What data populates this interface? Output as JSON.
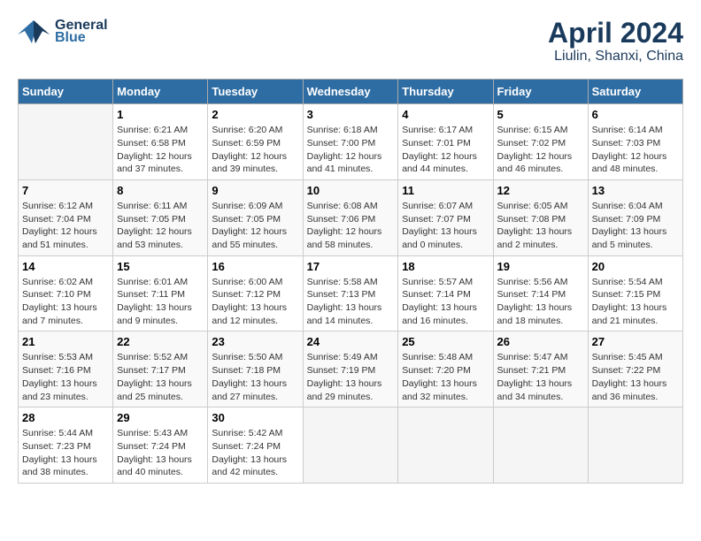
{
  "header": {
    "logo_line1": "General",
    "logo_line2": "Blue",
    "title": "April 2024",
    "subtitle": "Liulin, Shanxi, China"
  },
  "columns": [
    "Sunday",
    "Monday",
    "Tuesday",
    "Wednesday",
    "Thursday",
    "Friday",
    "Saturday"
  ],
  "weeks": [
    [
      {
        "num": "",
        "info": ""
      },
      {
        "num": "1",
        "info": "Sunrise: 6:21 AM\nSunset: 6:58 PM\nDaylight: 12 hours\nand 37 minutes."
      },
      {
        "num": "2",
        "info": "Sunrise: 6:20 AM\nSunset: 6:59 PM\nDaylight: 12 hours\nand 39 minutes."
      },
      {
        "num": "3",
        "info": "Sunrise: 6:18 AM\nSunset: 7:00 PM\nDaylight: 12 hours\nand 41 minutes."
      },
      {
        "num": "4",
        "info": "Sunrise: 6:17 AM\nSunset: 7:01 PM\nDaylight: 12 hours\nand 44 minutes."
      },
      {
        "num": "5",
        "info": "Sunrise: 6:15 AM\nSunset: 7:02 PM\nDaylight: 12 hours\nand 46 minutes."
      },
      {
        "num": "6",
        "info": "Sunrise: 6:14 AM\nSunset: 7:03 PM\nDaylight: 12 hours\nand 48 minutes."
      }
    ],
    [
      {
        "num": "7",
        "info": "Sunrise: 6:12 AM\nSunset: 7:04 PM\nDaylight: 12 hours\nand 51 minutes."
      },
      {
        "num": "8",
        "info": "Sunrise: 6:11 AM\nSunset: 7:05 PM\nDaylight: 12 hours\nand 53 minutes."
      },
      {
        "num": "9",
        "info": "Sunrise: 6:09 AM\nSunset: 7:05 PM\nDaylight: 12 hours\nand 55 minutes."
      },
      {
        "num": "10",
        "info": "Sunrise: 6:08 AM\nSunset: 7:06 PM\nDaylight: 12 hours\nand 58 minutes."
      },
      {
        "num": "11",
        "info": "Sunrise: 6:07 AM\nSunset: 7:07 PM\nDaylight: 13 hours\nand 0 minutes."
      },
      {
        "num": "12",
        "info": "Sunrise: 6:05 AM\nSunset: 7:08 PM\nDaylight: 13 hours\nand 2 minutes."
      },
      {
        "num": "13",
        "info": "Sunrise: 6:04 AM\nSunset: 7:09 PM\nDaylight: 13 hours\nand 5 minutes."
      }
    ],
    [
      {
        "num": "14",
        "info": "Sunrise: 6:02 AM\nSunset: 7:10 PM\nDaylight: 13 hours\nand 7 minutes."
      },
      {
        "num": "15",
        "info": "Sunrise: 6:01 AM\nSunset: 7:11 PM\nDaylight: 13 hours\nand 9 minutes."
      },
      {
        "num": "16",
        "info": "Sunrise: 6:00 AM\nSunset: 7:12 PM\nDaylight: 13 hours\nand 12 minutes."
      },
      {
        "num": "17",
        "info": "Sunrise: 5:58 AM\nSunset: 7:13 PM\nDaylight: 13 hours\nand 14 minutes."
      },
      {
        "num": "18",
        "info": "Sunrise: 5:57 AM\nSunset: 7:14 PM\nDaylight: 13 hours\nand 16 minutes."
      },
      {
        "num": "19",
        "info": "Sunrise: 5:56 AM\nSunset: 7:14 PM\nDaylight: 13 hours\nand 18 minutes."
      },
      {
        "num": "20",
        "info": "Sunrise: 5:54 AM\nSunset: 7:15 PM\nDaylight: 13 hours\nand 21 minutes."
      }
    ],
    [
      {
        "num": "21",
        "info": "Sunrise: 5:53 AM\nSunset: 7:16 PM\nDaylight: 13 hours\nand 23 minutes."
      },
      {
        "num": "22",
        "info": "Sunrise: 5:52 AM\nSunset: 7:17 PM\nDaylight: 13 hours\nand 25 minutes."
      },
      {
        "num": "23",
        "info": "Sunrise: 5:50 AM\nSunset: 7:18 PM\nDaylight: 13 hours\nand 27 minutes."
      },
      {
        "num": "24",
        "info": "Sunrise: 5:49 AM\nSunset: 7:19 PM\nDaylight: 13 hours\nand 29 minutes."
      },
      {
        "num": "25",
        "info": "Sunrise: 5:48 AM\nSunset: 7:20 PM\nDaylight: 13 hours\nand 32 minutes."
      },
      {
        "num": "26",
        "info": "Sunrise: 5:47 AM\nSunset: 7:21 PM\nDaylight: 13 hours\nand 34 minutes."
      },
      {
        "num": "27",
        "info": "Sunrise: 5:45 AM\nSunset: 7:22 PM\nDaylight: 13 hours\nand 36 minutes."
      }
    ],
    [
      {
        "num": "28",
        "info": "Sunrise: 5:44 AM\nSunset: 7:23 PM\nDaylight: 13 hours\nand 38 minutes."
      },
      {
        "num": "29",
        "info": "Sunrise: 5:43 AM\nSunset: 7:24 PM\nDaylight: 13 hours\nand 40 minutes."
      },
      {
        "num": "30",
        "info": "Sunrise: 5:42 AM\nSunset: 7:24 PM\nDaylight: 13 hours\nand 42 minutes."
      },
      {
        "num": "",
        "info": ""
      },
      {
        "num": "",
        "info": ""
      },
      {
        "num": "",
        "info": ""
      },
      {
        "num": "",
        "info": ""
      }
    ]
  ]
}
